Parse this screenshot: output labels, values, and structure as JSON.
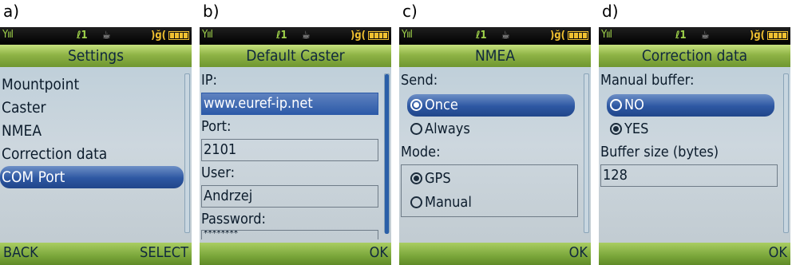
{
  "panels": {
    "a": {
      "letter": "a)",
      "title": "Settings",
      "items": [
        "Mountpoint",
        "Caster",
        "NMEA",
        "Correction data",
        "COM Port"
      ],
      "selected_item": 4,
      "softkeys": {
        "left": "BACK",
        "right": "SELECT"
      }
    },
    "b": {
      "letter": "b)",
      "title": "Default Caster",
      "ip_label": "IP:",
      "ip_value": "www.euref-ip.net",
      "port_label": "Port:",
      "port_value": "2101",
      "user_label": "User:",
      "user_value": "Andrzej",
      "password_label": "Password:",
      "password_value": "********",
      "softkeys": {
        "left": "",
        "right": "OK"
      }
    },
    "c": {
      "letter": "c)",
      "title": "NMEA",
      "send_label": "Send:",
      "send_options": [
        "Once",
        "Always"
      ],
      "send_selected": 0,
      "mode_label": "Mode:",
      "mode_options": [
        "GPS",
        "Manual"
      ],
      "mode_selected": 0,
      "softkeys": {
        "left": "",
        "right": "OK"
      }
    },
    "d": {
      "letter": "d)",
      "title": "Correction data",
      "manual_buffer_label": "Manual buffer:",
      "buffer_options": [
        "NO",
        "YES"
      ],
      "buffer_selected": 1,
      "buffer_size_label": "Buffer size (bytes)",
      "buffer_size_value": "128",
      "softkeys": {
        "left": "",
        "right": "OK"
      }
    }
  },
  "statusbar": {
    "signal": "Yııl",
    "line": "ℓ1",
    "vibrate": ")ğ("
  },
  "colors": {
    "title_green": "#8fb446",
    "selection_blue": "#2d57a2",
    "screen_bg": "#c6d2da"
  },
  "icons": {
    "signal": "signal-strength-icon",
    "line": "line-1-icon",
    "java": "java-cup-icon",
    "vibrate": "vibrate-icon",
    "battery": "battery-icon"
  }
}
